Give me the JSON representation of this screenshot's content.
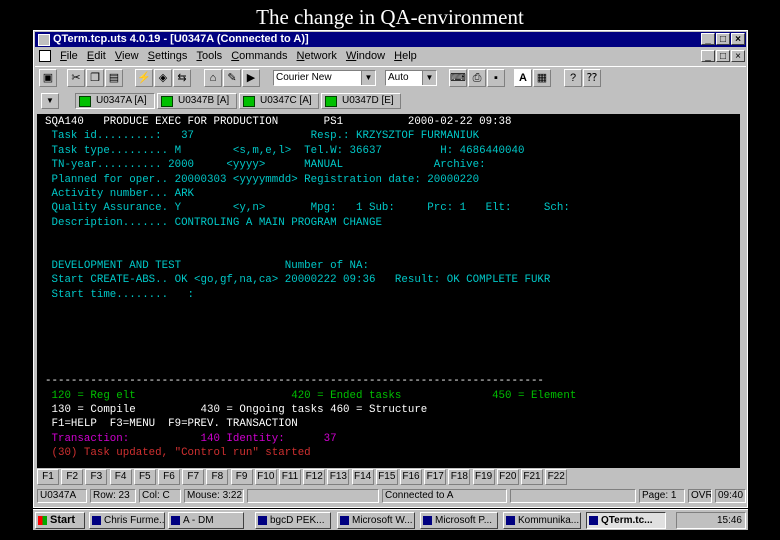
{
  "slide": {
    "title": "The change in QA-environment"
  },
  "window": {
    "title": "QTerm.tcp.uts 4.0.19 - [U0347A (Connected to A)]",
    "controls": [
      "_",
      "□",
      "×"
    ],
    "mdi_controls": [
      "_",
      "□",
      "×"
    ]
  },
  "menu": [
    "File",
    "Edit",
    "View",
    "Settings",
    "Tools",
    "Commands",
    "Network",
    "Window",
    "Help"
  ],
  "toolbar": {
    "font_value": "Courier New",
    "size_value": "Auto",
    "letter_a": "A",
    "help_q": "?"
  },
  "sessions": [
    {
      "label": "U0347A [A]"
    },
    {
      "label": "U0347B [A]"
    },
    {
      "label": "U0347C [A]"
    },
    {
      "label": "U0347D [E]"
    }
  ],
  "terminal": {
    "lines": [
      {
        "text": "SQA140   PRODUCE EXEC FOR PRODUCTION       PS1          2000-02-22 09:38",
        "color": "#ffffff"
      },
      {
        "text": " Task id.........:   37                  Resp.: KRZYSZTOF FURMANIUK",
        "color": "#00c8c8"
      },
      {
        "text": " Task type......... M        <s,m,e,l>  Tel.W: 36637         H: 4686440040",
        "color": "#00c8c8"
      },
      {
        "text": " TN-year.......... 2000     <yyyy>      MANUAL              Archive:",
        "color": "#00c8c8"
      },
      {
        "text": " Planned for oper.. 20000303 <yyyymmdd> Registration date: 20000220",
        "color": "#00c8c8"
      },
      {
        "text": " Activity number... ARK",
        "color": "#00c8c8"
      },
      {
        "text": " Quality Assurance. Y        <y,n>       Mpg:   1 Sub:     Prc: 1   Elt:     Sch:",
        "color": "#00c8c8"
      },
      {
        "text": " Description....... CONTROLING A MAIN PROGRAM CHANGE",
        "color": "#00c8c8"
      },
      {
        "text": "",
        "color": "#00c8c8"
      },
      {
        "text": "",
        "color": "#00c8c8"
      },
      {
        "text": " DEVELOPMENT AND TEST                Number of NA:",
        "color": "#00c8c8"
      },
      {
        "text": " Start CREATE-ABS.. OK <go,gf,na,ca> 20000222 09:36   Result: OK COMPLETE FUKR",
        "color": "#00c8c8"
      },
      {
        "text": " Start time........   :",
        "color": "#00c8c8"
      },
      {
        "text": "",
        "color": "#00c8c8"
      },
      {
        "text": "",
        "color": "#00c8c8"
      },
      {
        "text": "",
        "color": "#00c8c8"
      },
      {
        "text": "",
        "color": "#00c8c8"
      },
      {
        "text": "",
        "color": "#00c8c8"
      },
      {
        "text": "-----------------------------------------------------------------------------",
        "color": "#ffffff"
      },
      {
        "text": " 120 = Reg elt                        420 = Ended tasks              450 = Element",
        "color": "#00c000"
      },
      {
        "text": " 130 = Compile          430 = Ongoing tasks 460 = Structure",
        "color": "#ffffff"
      },
      {
        "text": " F1=HELP  F3=MENU  F9=PREV. TRANSACTION",
        "color": "#ffffff"
      },
      {
        "text": " Transaction:           140 Identity:      37",
        "color": "#d000d0"
      },
      {
        "text": " (30) Task updated, \"Control run\" started",
        "color": "#d03030"
      }
    ]
  },
  "fkeys": [
    "F1",
    "F2",
    "F3",
    "F4",
    "F5",
    "F6",
    "F7",
    "F8",
    "F9",
    "F10",
    "F11",
    "F12",
    "F13",
    "F14",
    "F15",
    "F16",
    "F17",
    "F18",
    "F19",
    "F20",
    "F21",
    "F22"
  ],
  "status": {
    "session": "U0347A",
    "row": "Row: 23",
    "col": "Col: C",
    "mouse": "Mouse: 3:22",
    "connected": "Connected to A",
    "page": "Page: 1",
    "ovr": "OVR",
    "time": "09:40"
  },
  "taskbar": {
    "start": "Start",
    "items": [
      "Chris Furme...",
      "A - DM",
      "bgcD PEK...",
      "Microsoft W...",
      "Microsoft P...",
      "Kommunika...",
      "QTerm.tc..."
    ],
    "clock": "15:46"
  }
}
